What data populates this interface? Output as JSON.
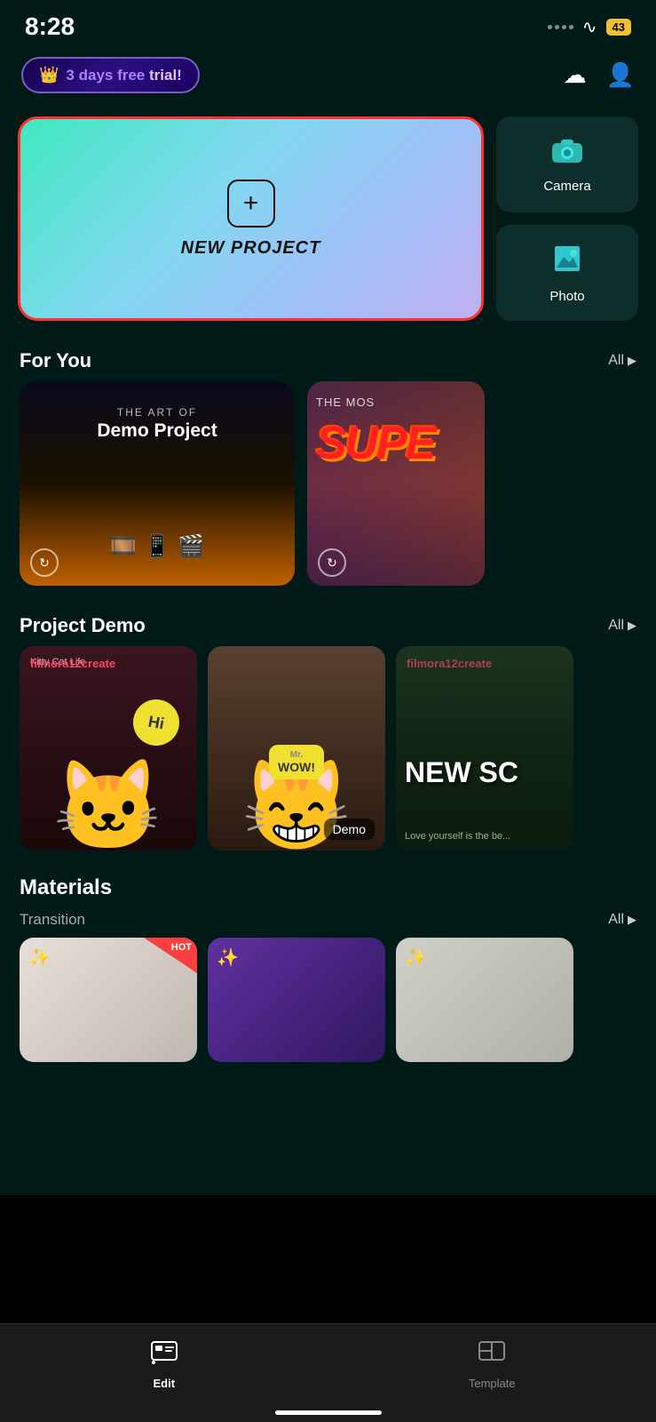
{
  "statusBar": {
    "time": "8:28",
    "battery": "43"
  },
  "header": {
    "trialText1": "3 days free",
    "trialText2": "trial!",
    "crownIcon": "👑"
  },
  "newProject": {
    "label": "NEW PROJECT"
  },
  "sideCards": [
    {
      "label": "Camera",
      "icon": "📹"
    },
    {
      "label": "Photo",
      "icon": "🖼️"
    }
  ],
  "forYou": {
    "sectionTitle": "For You",
    "allLabel": "All",
    "cards": [
      {
        "artOf": "THE ART OF",
        "title": "Demo Project",
        "replayIcon": "↻"
      },
      {
        "mostText": "THE MOS",
        "superText": "SUPE",
        "replayIcon": "↻"
      }
    ]
  },
  "projectDemo": {
    "sectionTitle": "Project Demo",
    "allLabel": "All",
    "cards": [
      {
        "tag": "filmora12create",
        "kittyTag": "Kitty Cat Life",
        "bubble": "Hi",
        "emoji": "🐱"
      },
      {
        "bubble": "WOW!",
        "emoji": "🐱",
        "demoLabel": "Demo"
      },
      {
        "tag": "filmora12create",
        "newScText": "NEW SC",
        "loveText": "Love yourself is the be..."
      }
    ]
  },
  "materials": {
    "sectionTitle": "Materials",
    "transition": {
      "label": "Transition",
      "allLabel": "All"
    },
    "cards": [
      {
        "hotLabel": "HOT",
        "icon": "✨"
      },
      {
        "icon": "✨"
      },
      {
        "icon": "✨"
      }
    ]
  },
  "bottomNav": {
    "editLabel": "Edit",
    "templateLabel": "Template"
  }
}
